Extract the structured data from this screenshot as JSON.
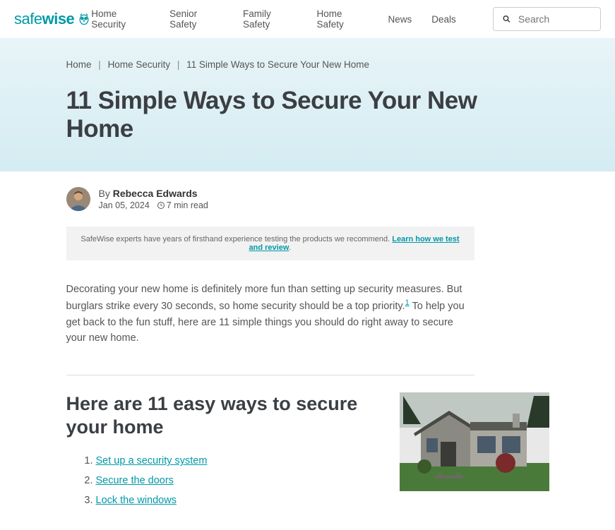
{
  "logo": {
    "safe": "safe",
    "wise": "wise"
  },
  "nav": {
    "items": [
      "Home Security",
      "Senior Safety",
      "Family Safety",
      "Home Safety",
      "News",
      "Deals"
    ],
    "search_placeholder": "Search"
  },
  "breadcrumb": {
    "home": "Home",
    "cat": "Home Security",
    "current": "11 Simple Ways to Secure Your New Home"
  },
  "title": "11 Simple Ways to Secure Your New Home",
  "author": {
    "by": "By ",
    "name": "Rebecca Edwards",
    "date": "Jan 05, 2024",
    "read": "7 min read"
  },
  "disclaimer": {
    "text": "SafeWise experts have years of firsthand experience testing the products we recommend. ",
    "link": "Learn how we test and review"
  },
  "intro": {
    "part1": "Decorating your new home is definitely more fun than setting up security measures. But burglars strike every 30 seconds, so home security should be a top priority.",
    "sup": "1",
    "part2": " To help you get back to the fun stuff, here are 11 simple things you should do right away to secure your new home."
  },
  "ways": {
    "heading": "Here are 11 easy ways to secure your home",
    "items": [
      "Set up a security system",
      "Secure the doors",
      "Lock the windows"
    ]
  }
}
